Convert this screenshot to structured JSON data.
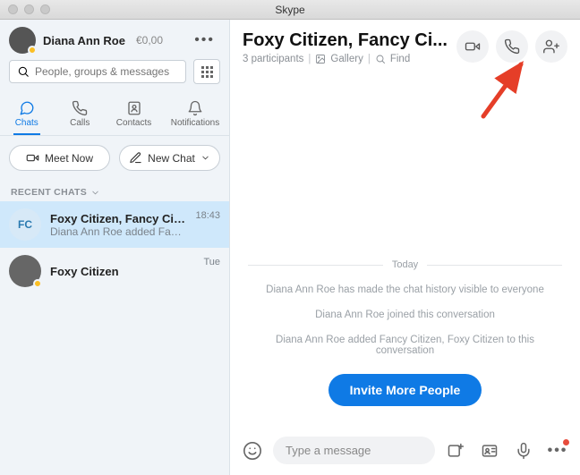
{
  "window": {
    "title": "Skype"
  },
  "user": {
    "name": "Diana Ann Roe",
    "balance": "€0,00"
  },
  "search": {
    "placeholder": "People, groups & messages"
  },
  "nav": {
    "chats": "Chats",
    "calls": "Calls",
    "contacts": "Contacts",
    "notifications": "Notifications"
  },
  "actions": {
    "meet_now": "Meet Now",
    "new_chat": "New Chat"
  },
  "recent_header": "RECENT CHATS",
  "chats": [
    {
      "avatar_initials": "FC",
      "name": "Foxy Citizen, Fancy Citizen",
      "preview": "Diana Ann Roe added Fancy …",
      "time": "18:43"
    },
    {
      "avatar_initials": "",
      "name": "Foxy Citizen",
      "preview": "",
      "time": "Tue"
    }
  ],
  "conversation": {
    "title": "Foxy Citizen, Fancy Ci...",
    "participants": "3 participants",
    "gallery": "Gallery",
    "find": "Find",
    "day_label": "Today",
    "system_messages": [
      "Diana Ann Roe has made the chat history visible to everyone",
      "Diana Ann Roe joined this conversation",
      "Diana Ann Roe added Fancy Citizen, Foxy Citizen to this conversation"
    ],
    "invite_label": "Invite More People"
  },
  "composer": {
    "placeholder": "Type a message"
  }
}
